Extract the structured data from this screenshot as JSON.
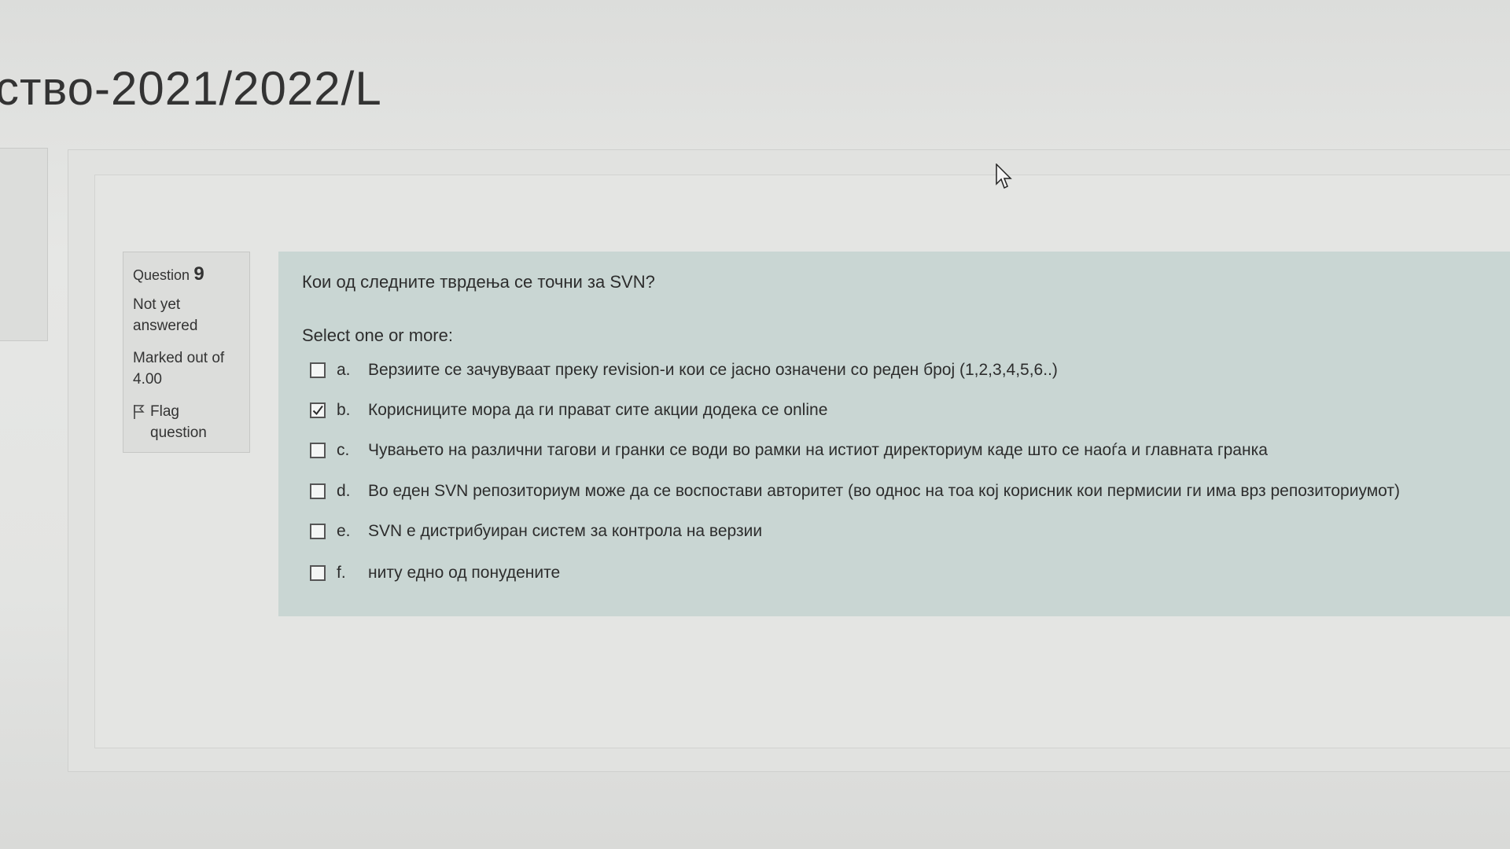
{
  "page": {
    "title": "ство-2021/2022/L"
  },
  "question_info": {
    "label": "Question",
    "number": "9",
    "state": "Not yet answered",
    "grade": "Marked out of 4.00",
    "flag_label": "Flag question"
  },
  "question": {
    "text": "Кои од следните тврдења се точни за SVN?",
    "prompt": "Select one or more:",
    "answers": [
      {
        "letter": "a.",
        "text": "Верзиите се зачувуваат преку revision-и кои се јасно означени со реден број (1,2,3,4,5,6..)",
        "checked": false
      },
      {
        "letter": "b.",
        "text": "Корисниците мора да ги прават сите акции додека се online",
        "checked": true
      },
      {
        "letter": "c.",
        "text": "Чувањето на различни тагови и гранки се води во рамки на истиот директориум каде што се наоѓа и главната гранка",
        "checked": false
      },
      {
        "letter": "d.",
        "text": "Во еден SVN репозиториум може да се воспостави авторитет (во однос на тоа кој корисник кои пермисии ги има врз репозиториумот)",
        "checked": false
      },
      {
        "letter": "e.",
        "text": "SVN е дистрибуиран систем за контрола на верзии",
        "checked": false
      },
      {
        "letter": "f.",
        "text": "ниту едно од понудените",
        "checked": false
      }
    ]
  },
  "colors": {
    "content_bg": "#c9d6d3",
    "info_bg": "#dcdddb"
  }
}
